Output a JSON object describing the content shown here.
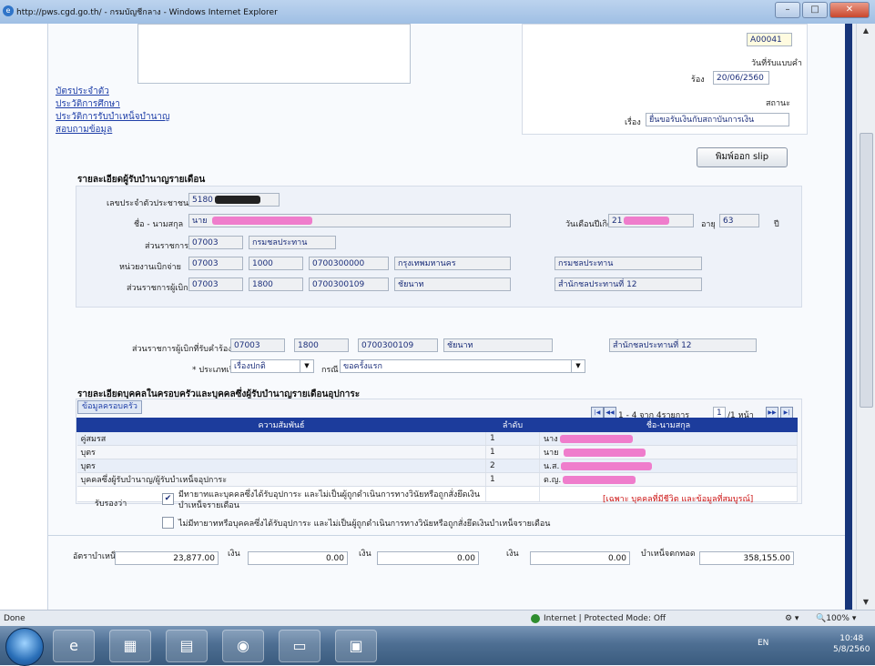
{
  "window": {
    "title": "http://pws.cgd.go.th/ - กรมบัญชีกลาง - Windows Internet Explorer",
    "minimize": "–",
    "maximize": "□",
    "close": "✕"
  },
  "top": {
    "links": [
      "บัตรประจำตัว",
      "ประวัติการศึกษา",
      "ประวัติการรับบำเหน็จบำนาญ",
      "สอบถามข้อมูล"
    ],
    "ref_no": "A00041",
    "receive_date_label": "วันที่รับแบบคำ",
    "receive_date_prefix": "ร้อง",
    "receive_date": "20/06/2560",
    "status_label": "สถานะ",
    "subject_prefix": "เรื่อง",
    "subject": "ยื่นขอรับเงินกับสถาบันการเงิน",
    "print_slip": "พิมพ์ออก slip"
  },
  "pensioner": {
    "heading": "รายละเอียดผู้รับบำนาญรายเดือน",
    "id_label": "เลขประจำตัวประชาชน",
    "id_value": "5180",
    "name_label": "ชื่อ - นามสกุล",
    "name_value": "นาย",
    "birth_label": "วันเดือนปีเกิด",
    "birth_value": "21",
    "age_label": "อายุ",
    "age_value": "63",
    "age_unit": "ปี",
    "agency_label": "ส่วนราชการ",
    "agency_code": "07003",
    "agency_name": "กรมชลประทาน",
    "disb_label": "หน่วยงานเบิกจ่าย",
    "disb_codes": [
      "07003",
      "1000",
      "0700300000"
    ],
    "disb_province": "กรุงเทพมหานคร",
    "disb_name": "กรมชลประทาน",
    "paying_label": "ส่วนราชการผู้เบิก",
    "paying_codes": [
      "07003",
      "1800",
      "0700300109"
    ],
    "paying_province": "ชัยนาท",
    "paying_name": "สำนักชลประทานที่ 12"
  },
  "request": {
    "office_label": "ส่วนราชการผู้เบิกที่รับคำร้อง",
    "office_codes": [
      "07003",
      "1800",
      "0700300109"
    ],
    "office_province": "ชัยนาท",
    "office_name": "สำนักชลประทานที่ 12",
    "type_label": "* ประเภทเรื่อง",
    "type_value": "เรื่องปกติ",
    "case_label": "กรณี",
    "case_value": "ขอครั้งแรก"
  },
  "family": {
    "heading": "รายละเอียดบุคคลในครอบครัวและบุคคลซึ่งผู้รับบำนาญรายเดือนอุปการะ",
    "tab": "ข้อมูลครอบครัว",
    "pager_text": "1 - 4 จาก 4รายการ",
    "pager_page": "1",
    "pager_total": "/1 หน้า",
    "columns": [
      "ความสัมพันธ์",
      "ลำดับ",
      "ชื่อ-นามสกุล"
    ],
    "rows": [
      {
        "relation": "คู่สมรส",
        "order": "1",
        "name": "นาง"
      },
      {
        "relation": "บุตร",
        "order": "1",
        "name": "นาย"
      },
      {
        "relation": "บุตร",
        "order": "2",
        "name": "น.ส."
      },
      {
        "relation": "บุคคลซึ่งผู้รับบำนาญ/ผู้รับบำเหน็จอุปการะ",
        "order": "1",
        "name": "ด.ญ."
      }
    ],
    "confirm_label": "รับรองว่า",
    "check1": "มีทายาทและบุคคลซึ่งได้รับอุปการะ และไม่เป็นผู้ถูกดำเนินการทางวินัยหรือถูกสั่งยึดเงินบำเหน็จรายเดือน",
    "check2": "ไม่มีทายาทหรือบุคคลซึ่งได้รับอุปการะ และไม่เป็นผู้ถูกดำเนินการทางวินัยหรือถูกสั่งยึดเงินบำเหน็จรายเดือน",
    "note": "[เฉพาะ บุคคลที่มีชีวิต และข้อมูลที่สมบูรณ์]"
  },
  "amounts": {
    "rate_label": "อัตราบำเหน็จ",
    "rate_value": "23,877.00",
    "money_label": "เงิน",
    "v1": "0.00",
    "v2": "0.00",
    "v3": "0.00",
    "lump_label": "บำเหน็จตกทอด",
    "lump_value": "358,155.00"
  },
  "status": {
    "done": "Done",
    "zone": "Internet | Protected Mode: Off",
    "zoom": "100%"
  },
  "taskbar": {
    "lang": "EN",
    "time": "10:48",
    "date": "5/8/2560"
  },
  "colors": {
    "header_blue": "#1c3c9c",
    "redaction": "#ef7dcc",
    "note_red": "#cc1111"
  }
}
